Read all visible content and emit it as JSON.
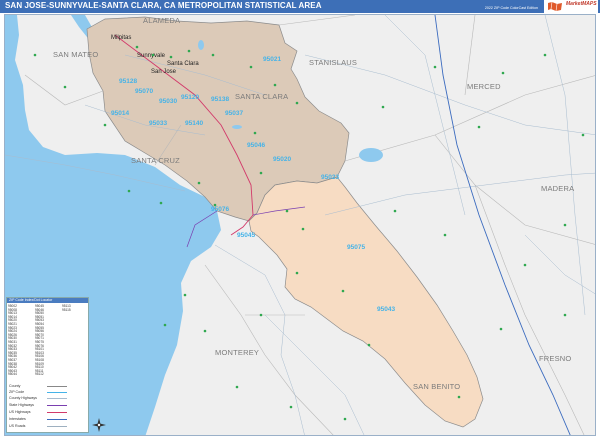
{
  "header": {
    "title": "SAN JOSE-SUNNYVALE-SANTA CLARA, CA METROPOLITAN STATISTICAL AREA",
    "edition": "2022 ZIP Code ColorCast Edition"
  },
  "logo": {
    "name": "MarketMAPS"
  },
  "colors": {
    "ocean": "#8ec9ee",
    "land": "#efefef",
    "santa_clara": "#dccab8",
    "san_benito": "#f7dcc3",
    "zip_label": "#45b3e8",
    "county_label": "#7b7b7b",
    "highway": "#d23a6a",
    "road": "#9eb0c0"
  },
  "counties": [
    {
      "name": "SAN MATEO"
    },
    {
      "name": "STANISLAUS"
    },
    {
      "name": "MERCED"
    },
    {
      "name": "SANTA CLARA"
    },
    {
      "name": "SANTA CRUZ"
    },
    {
      "name": "MADERA"
    },
    {
      "name": "MONTEREY"
    },
    {
      "name": "FRESNO"
    },
    {
      "name": "SAN BENITO"
    },
    {
      "name": "ALAMEDA"
    }
  ],
  "zips": [
    "95021",
    "95014",
    "95070",
    "95030",
    "95033",
    "95120",
    "95138",
    "95037",
    "95046",
    "95020",
    "95023",
    "95045",
    "95075",
    "95043",
    "95140",
    "95128",
    "95076"
  ],
  "cities": [
    "Sunnyvale",
    "Santa Clara",
    "San Jose",
    "Milpitas"
  ],
  "legend": {
    "title": "ZIP Code Index/Dot Locator",
    "rows": [
      "95002",
      "95008",
      "95013",
      "95014",
      "95020",
      "95021",
      "95023",
      "95024",
      "95026",
      "95030",
      "95031",
      "95032",
      "95033",
      "95035",
      "95036",
      "95037",
      "95038",
      "95042",
      "95043",
      "95044",
      "95045",
      "95046",
      "95050",
      "95051",
      "95053",
      "95054",
      "95055",
      "95056",
      "95070",
      "95071",
      "95075",
      "95076",
      "95101",
      "95103",
      "95106",
      "95108",
      "95109",
      "95110",
      "95111",
      "95112",
      "95113",
      "95115"
    ],
    "key": [
      {
        "label": "County"
      },
      {
        "label": "ZIP Code"
      },
      {
        "label": "County Highways"
      },
      {
        "label": "State Highways"
      },
      {
        "label": "US Highways"
      },
      {
        "label": "Interstates"
      },
      {
        "label": "US Roads"
      }
    ]
  }
}
